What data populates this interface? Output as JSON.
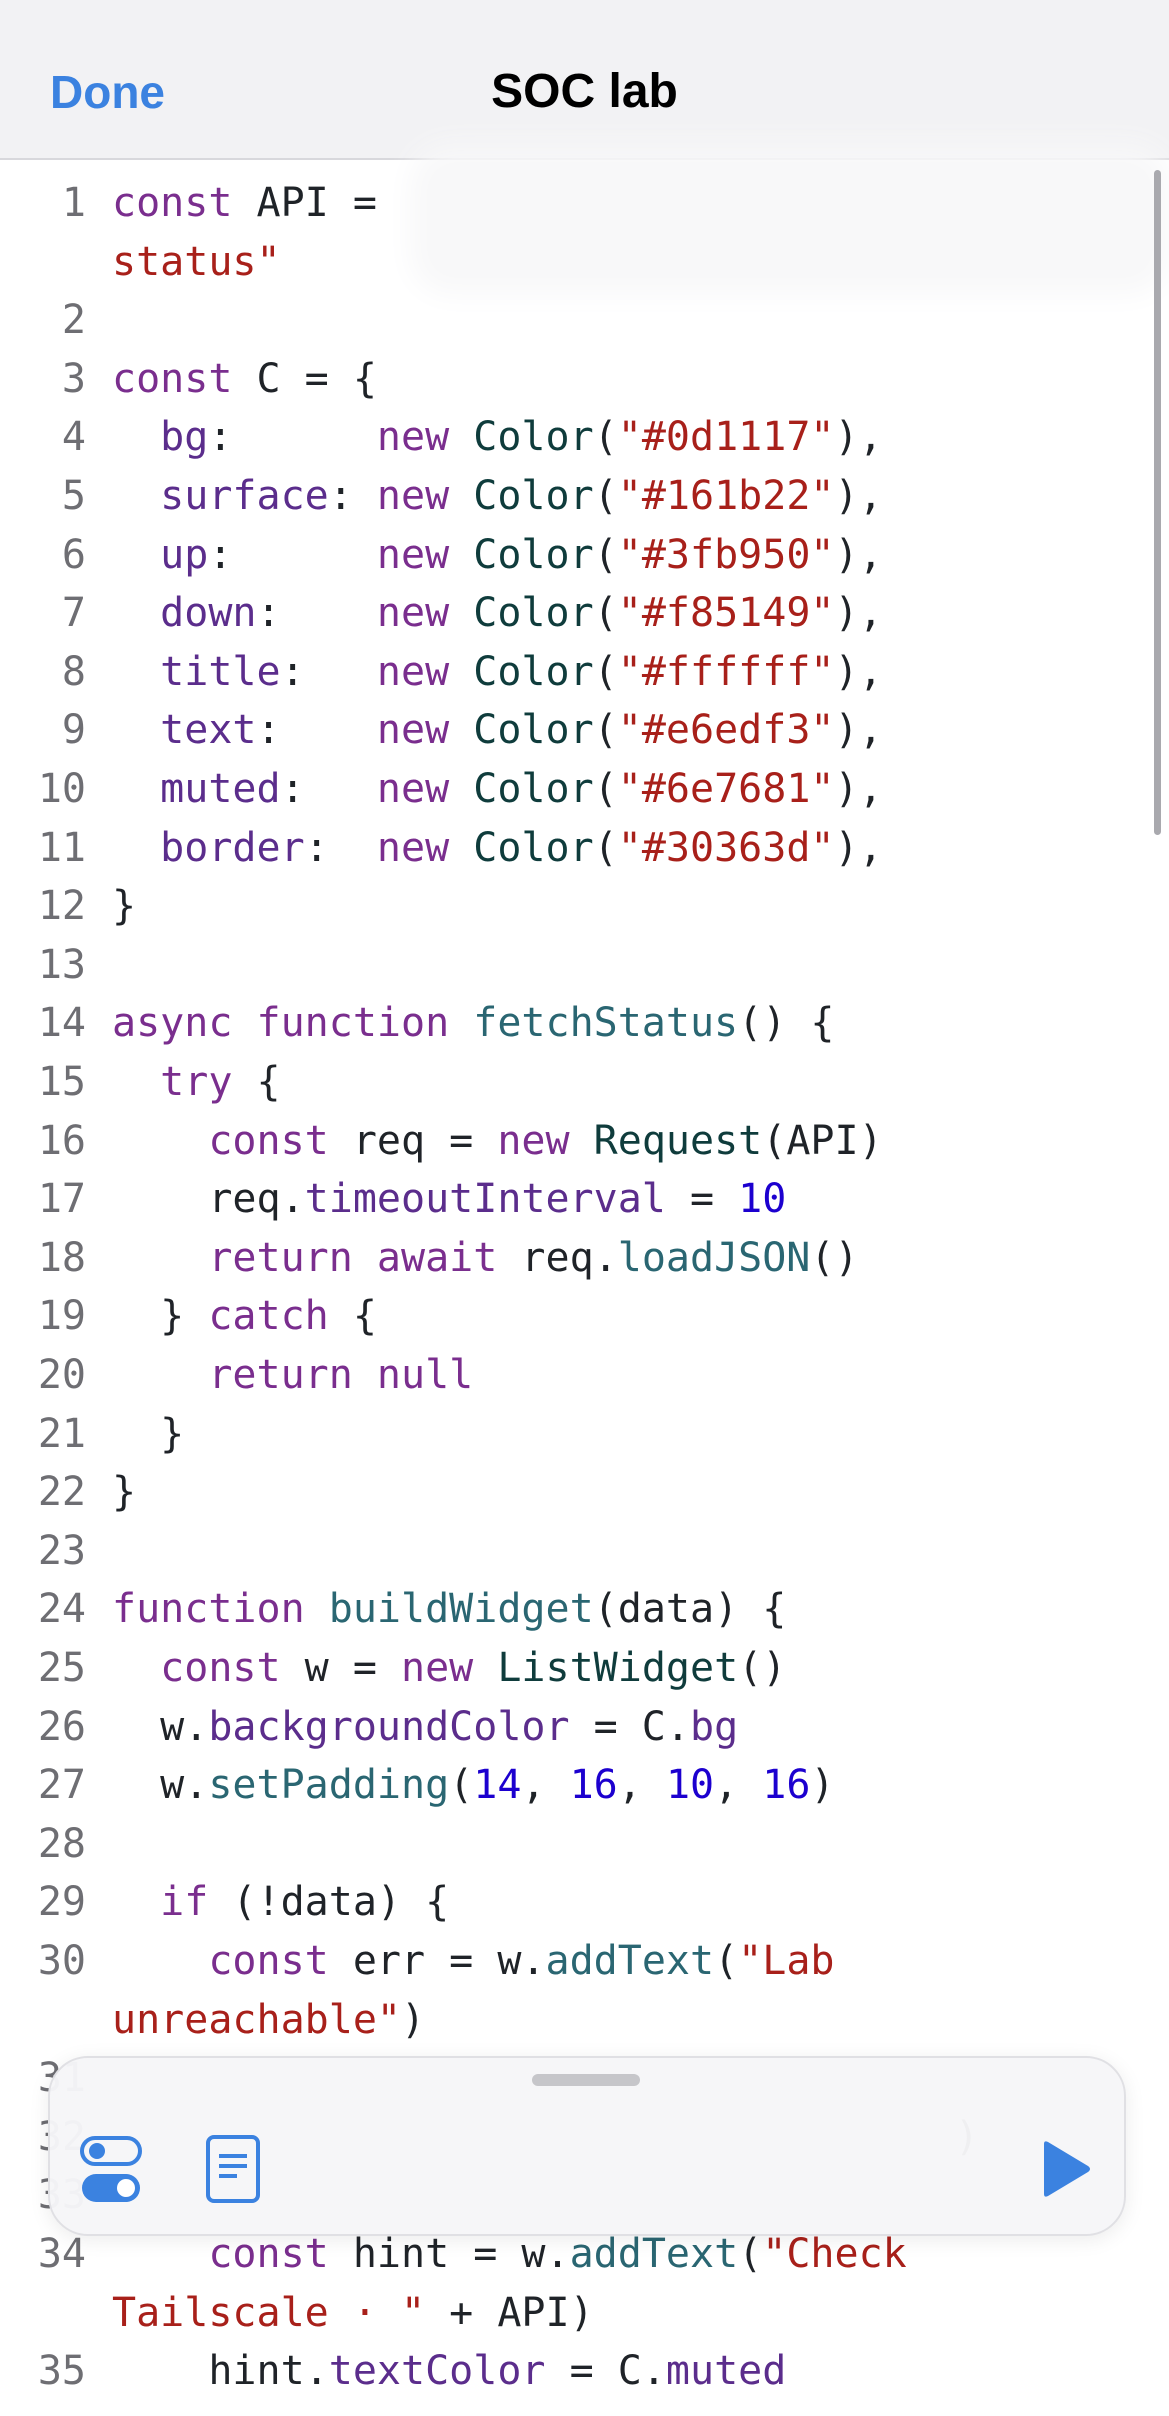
{
  "navbar": {
    "done_label": "Done",
    "title": "SOC lab"
  },
  "editor": {
    "lines": [
      {
        "n": "1",
        "tokens": [
          [
            "kw",
            "const "
          ],
          [
            "plain",
            "API ="
          ]
        ]
      },
      {
        "n": "",
        "tokens": [
          [
            "str",
            "status\""
          ]
        ]
      },
      {
        "n": "2",
        "tokens": []
      },
      {
        "n": "3",
        "tokens": [
          [
            "kw",
            "const "
          ],
          [
            "plain",
            "C = {"
          ]
        ]
      },
      {
        "n": "4",
        "tokens": [
          [
            "plain",
            "  "
          ],
          [
            "prop",
            "bg"
          ],
          [
            "plain",
            ":      "
          ],
          [
            "kw",
            "new "
          ],
          [
            "typ",
            "Color"
          ],
          [
            "plain",
            "("
          ],
          [
            "str",
            "\"#0d1117\""
          ],
          [
            "plain",
            "),"
          ]
        ]
      },
      {
        "n": "5",
        "tokens": [
          [
            "plain",
            "  "
          ],
          [
            "prop",
            "surface"
          ],
          [
            "plain",
            ": "
          ],
          [
            "kw",
            "new "
          ],
          [
            "typ",
            "Color"
          ],
          [
            "plain",
            "("
          ],
          [
            "str",
            "\"#161b22\""
          ],
          [
            "plain",
            "),"
          ]
        ]
      },
      {
        "n": "6",
        "tokens": [
          [
            "plain",
            "  "
          ],
          [
            "prop",
            "up"
          ],
          [
            "plain",
            ":      "
          ],
          [
            "kw",
            "new "
          ],
          [
            "typ",
            "Color"
          ],
          [
            "plain",
            "("
          ],
          [
            "str",
            "\"#3fb950\""
          ],
          [
            "plain",
            "),"
          ]
        ]
      },
      {
        "n": "7",
        "tokens": [
          [
            "plain",
            "  "
          ],
          [
            "prop",
            "down"
          ],
          [
            "plain",
            ":    "
          ],
          [
            "kw",
            "new "
          ],
          [
            "typ",
            "Color"
          ],
          [
            "plain",
            "("
          ],
          [
            "str",
            "\"#f85149\""
          ],
          [
            "plain",
            "),"
          ]
        ]
      },
      {
        "n": "8",
        "tokens": [
          [
            "plain",
            "  "
          ],
          [
            "prop",
            "title"
          ],
          [
            "plain",
            ":   "
          ],
          [
            "kw",
            "new "
          ],
          [
            "typ",
            "Color"
          ],
          [
            "plain",
            "("
          ],
          [
            "str",
            "\"#ffffff\""
          ],
          [
            "plain",
            "),"
          ]
        ]
      },
      {
        "n": "9",
        "tokens": [
          [
            "plain",
            "  "
          ],
          [
            "prop",
            "text"
          ],
          [
            "plain",
            ":    "
          ],
          [
            "kw",
            "new "
          ],
          [
            "typ",
            "Color"
          ],
          [
            "plain",
            "("
          ],
          [
            "str",
            "\"#e6edf3\""
          ],
          [
            "plain",
            "),"
          ]
        ]
      },
      {
        "n": "10",
        "tokens": [
          [
            "plain",
            "  "
          ],
          [
            "prop",
            "muted"
          ],
          [
            "plain",
            ":   "
          ],
          [
            "kw",
            "new "
          ],
          [
            "typ",
            "Color"
          ],
          [
            "plain",
            "("
          ],
          [
            "str",
            "\"#6e7681\""
          ],
          [
            "plain",
            "),"
          ]
        ]
      },
      {
        "n": "11",
        "tokens": [
          [
            "plain",
            "  "
          ],
          [
            "prop",
            "border"
          ],
          [
            "plain",
            ":  "
          ],
          [
            "kw",
            "new "
          ],
          [
            "typ",
            "Color"
          ],
          [
            "plain",
            "("
          ],
          [
            "str",
            "\"#30363d\""
          ],
          [
            "plain",
            "),"
          ]
        ]
      },
      {
        "n": "12",
        "tokens": [
          [
            "plain",
            "}"
          ]
        ]
      },
      {
        "n": "13",
        "tokens": []
      },
      {
        "n": "14",
        "tokens": [
          [
            "kw",
            "async function "
          ],
          [
            "fn",
            "fetchStatus"
          ],
          [
            "plain",
            "() {"
          ]
        ]
      },
      {
        "n": "15",
        "tokens": [
          [
            "plain",
            "  "
          ],
          [
            "kw",
            "try "
          ],
          [
            "plain",
            "{"
          ]
        ]
      },
      {
        "n": "16",
        "tokens": [
          [
            "plain",
            "    "
          ],
          [
            "kw",
            "const "
          ],
          [
            "plain",
            "req = "
          ],
          [
            "kw",
            "new "
          ],
          [
            "typ",
            "Request"
          ],
          [
            "plain",
            "(API)"
          ]
        ]
      },
      {
        "n": "17",
        "tokens": [
          [
            "plain",
            "    req."
          ],
          [
            "prop",
            "timeoutInterval"
          ],
          [
            "plain",
            " = "
          ],
          [
            "num",
            "10"
          ]
        ]
      },
      {
        "n": "18",
        "tokens": [
          [
            "plain",
            "    "
          ],
          [
            "kw",
            "return await "
          ],
          [
            "plain",
            "req."
          ],
          [
            "fn",
            "loadJSON"
          ],
          [
            "plain",
            "()"
          ]
        ]
      },
      {
        "n": "19",
        "tokens": [
          [
            "plain",
            "  } "
          ],
          [
            "kw",
            "catch "
          ],
          [
            "plain",
            "{"
          ]
        ]
      },
      {
        "n": "20",
        "tokens": [
          [
            "plain",
            "    "
          ],
          [
            "kw",
            "return null"
          ]
        ]
      },
      {
        "n": "21",
        "tokens": [
          [
            "plain",
            "  }"
          ]
        ]
      },
      {
        "n": "22",
        "tokens": [
          [
            "plain",
            "}"
          ]
        ]
      },
      {
        "n": "23",
        "tokens": []
      },
      {
        "n": "24",
        "tokens": [
          [
            "kw",
            "function "
          ],
          [
            "fn",
            "buildWidget"
          ],
          [
            "plain",
            "(data) {"
          ]
        ]
      },
      {
        "n": "25",
        "tokens": [
          [
            "plain",
            "  "
          ],
          [
            "kw",
            "const "
          ],
          [
            "plain",
            "w = "
          ],
          [
            "kw",
            "new "
          ],
          [
            "typ",
            "ListWidget"
          ],
          [
            "plain",
            "()"
          ]
        ]
      },
      {
        "n": "26",
        "tokens": [
          [
            "plain",
            "  w."
          ],
          [
            "prop",
            "backgroundColor"
          ],
          [
            "plain",
            " = C."
          ],
          [
            "prop",
            "bg"
          ]
        ]
      },
      {
        "n": "27",
        "tokens": [
          [
            "plain",
            "  w."
          ],
          [
            "fn",
            "setPadding"
          ],
          [
            "plain",
            "("
          ],
          [
            "num",
            "14"
          ],
          [
            "plain",
            ", "
          ],
          [
            "num",
            "16"
          ],
          [
            "plain",
            ", "
          ],
          [
            "num",
            "10"
          ],
          [
            "plain",
            ", "
          ],
          [
            "num",
            "16"
          ],
          [
            "plain",
            ")"
          ]
        ]
      },
      {
        "n": "28",
        "tokens": []
      },
      {
        "n": "29",
        "tokens": [
          [
            "plain",
            "  "
          ],
          [
            "kw",
            "if "
          ],
          [
            "plain",
            "(!data) {"
          ]
        ]
      },
      {
        "n": "30",
        "tokens": [
          [
            "plain",
            "    "
          ],
          [
            "kw",
            "const "
          ],
          [
            "plain",
            "err = w."
          ],
          [
            "fn",
            "addText"
          ],
          [
            "plain",
            "("
          ],
          [
            "str",
            "\"Lab"
          ]
        ]
      },
      {
        "n": "",
        "tokens": [
          [
            "str",
            "unreachable\""
          ],
          [
            "plain",
            ")"
          ]
        ]
      },
      {
        "n": "31",
        "tokens": []
      },
      {
        "n": "32",
        "tokens": [
          [
            "plain",
            "                                   )"
          ]
        ]
      },
      {
        "n": "33",
        "tokens": []
      },
      {
        "n": "34",
        "tokens": [
          [
            "plain",
            "    "
          ],
          [
            "kw",
            "const "
          ],
          [
            "plain",
            "hint = w."
          ],
          [
            "fn",
            "addText"
          ],
          [
            "plain",
            "("
          ],
          [
            "str",
            "\"Check"
          ]
        ]
      },
      {
        "n": "",
        "tokens": [
          [
            "str",
            "Tailscale · \""
          ],
          [
            "plain",
            " + API)"
          ]
        ]
      },
      {
        "n": "35",
        "tokens": [
          [
            "plain",
            "    hint."
          ],
          [
            "prop",
            "textColor"
          ],
          [
            "plain",
            " = C."
          ],
          [
            "prop",
            "muted"
          ]
        ]
      }
    ]
  },
  "toolbar": {
    "settings_icon": "toggle-switches-icon",
    "docs_icon": "document-icon",
    "run_icon": "play-icon",
    "accent": "#3b82e0"
  }
}
